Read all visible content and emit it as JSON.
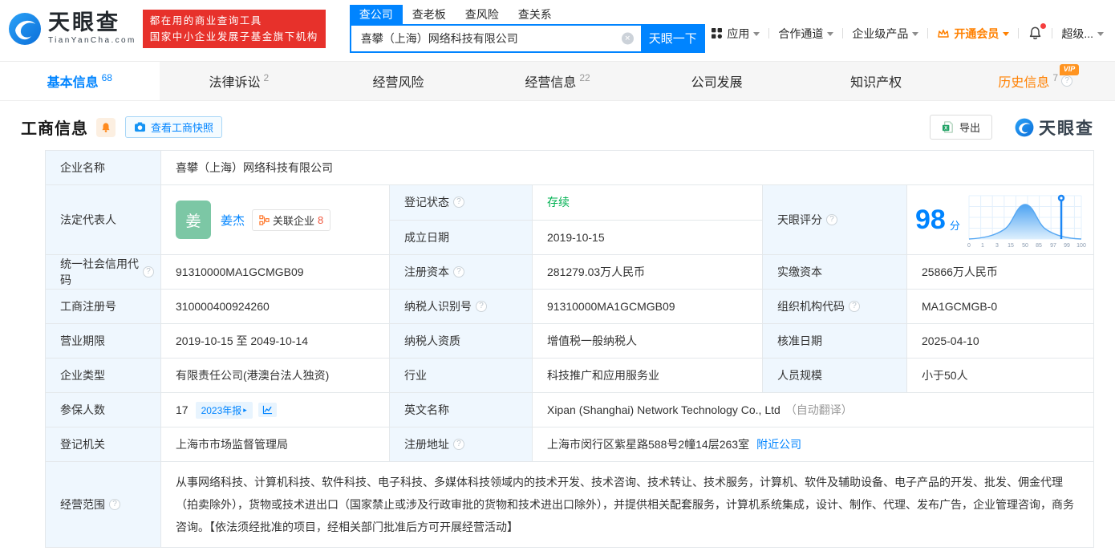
{
  "colors": {
    "accent_blue": "#0084ff",
    "banner_red": "#e7312b",
    "vip_orange": "#ff8000",
    "status_green": "#00b152",
    "avatar_green": "#7cc7a5",
    "label_cell_bg": "#eff7fe"
  },
  "icons": {
    "help": "?",
    "clear": "✕",
    "arrow": "▸"
  },
  "header": {
    "logo": {
      "brand": "天眼查",
      "domain": "TianYanCha.com"
    },
    "banner": {
      "line1": "都在用的商业查询工具",
      "line2": "国家中小企业发展子基金旗下机构"
    },
    "search": {
      "tabs": [
        {
          "label": "查公司"
        },
        {
          "label": "查老板"
        },
        {
          "label": "查风险"
        },
        {
          "label": "查关系"
        }
      ],
      "value": "喜攀（上海）网络科技有限公司",
      "button": "天眼一下"
    },
    "nav": [
      {
        "label": "应用"
      },
      {
        "label": "合作通道"
      },
      {
        "label": "企业级产品"
      },
      {
        "label": "开通会员"
      },
      {
        "label": "超级..."
      }
    ]
  },
  "tabs": [
    {
      "label": "基本信息",
      "count": "68"
    },
    {
      "label": "法律诉讼",
      "count": "2"
    },
    {
      "label": "经营风险",
      "count": ""
    },
    {
      "label": "经营信息",
      "count": "22"
    },
    {
      "label": "公司发展",
      "count": ""
    },
    {
      "label": "知识产权",
      "count": ""
    },
    {
      "label": "历史信息",
      "count": "7",
      "vip": "VIP"
    }
  ],
  "section": {
    "title": "工商信息",
    "snapshot": "查看工商快照",
    "export": "导出",
    "brand": "天眼查"
  },
  "info": {
    "company_name": {
      "label": "企业名称",
      "value": "喜攀（上海）网络科技有限公司"
    },
    "legal_rep": {
      "label": "法定代表人",
      "avatar": "姜",
      "name": "姜杰",
      "related_label": "关联企业",
      "related_count": "8"
    },
    "reg_status": {
      "label": "登记状态",
      "value": "存续"
    },
    "establish_date": {
      "label": "成立日期",
      "value": "2019-10-15"
    },
    "score": {
      "label": "天眼评分",
      "value": "98",
      "unit": "分",
      "axis": [
        "0",
        "1",
        "3",
        "15",
        "50",
        "85",
        "97",
        "99",
        "100"
      ]
    },
    "credit_code": {
      "label": "统一社会信用代码",
      "value": "91310000MA1GCMGB09"
    },
    "reg_capital": {
      "label": "注册资本",
      "value": "281279.03万人民币"
    },
    "paid_capital": {
      "label": "实缴资本",
      "value": "25866万人民币"
    },
    "reg_number": {
      "label": "工商注册号",
      "value": "310000400924260"
    },
    "taxpayer_id": {
      "label": "纳税人识别号",
      "value": "91310000MA1GCMGB09"
    },
    "org_code": {
      "label": "组织机构代码",
      "value": "MA1GCMGB-0"
    },
    "business_term": {
      "label": "营业期限",
      "value": "2019-10-15 至 2049-10-14"
    },
    "taxpayer_quality": {
      "label": "纳税人资质",
      "value": "增值税一般纳税人"
    },
    "approval_date": {
      "label": "核准日期",
      "value": "2025-04-10"
    },
    "company_type": {
      "label": "企业类型",
      "value": "有限责任公司(港澳台法人独资)"
    },
    "industry": {
      "label": "行业",
      "value": "科技推广和应用服务业"
    },
    "staff_size": {
      "label": "人员规模",
      "value": "小于50人"
    },
    "insured": {
      "label": "参保人数",
      "value": "17",
      "report": "2023年报"
    },
    "english_name": {
      "label": "英文名称",
      "value": "Xipan (Shanghai) Network Technology Co., Ltd",
      "note": "（自动翻译）"
    },
    "reg_authority": {
      "label": "登记机关",
      "value": "上海市市场监督管理局"
    },
    "reg_address": {
      "label": "注册地址",
      "value": "上海市闵行区紫星路588号2幢14层263室",
      "link": "附近公司"
    },
    "business_scope": {
      "label": "经营范围",
      "value": "从事网络科技、计算机科技、软件科技、电子科技、多媒体科技领域内的技术开发、技术咨询、技术转让、技术服务，计算机、软件及辅助设备、电子产品的开发、批发、佣金代理（拍卖除外），货物或技术进出口（国家禁止或涉及行政审批的货物和技术进出口除外），并提供相关配套服务，计算机系统集成，设计、制作、代理、发布广告，企业管理咨询，商务咨询。【依法须经批准的项目，经相关部门批准后方可开展经营活动】"
    }
  }
}
